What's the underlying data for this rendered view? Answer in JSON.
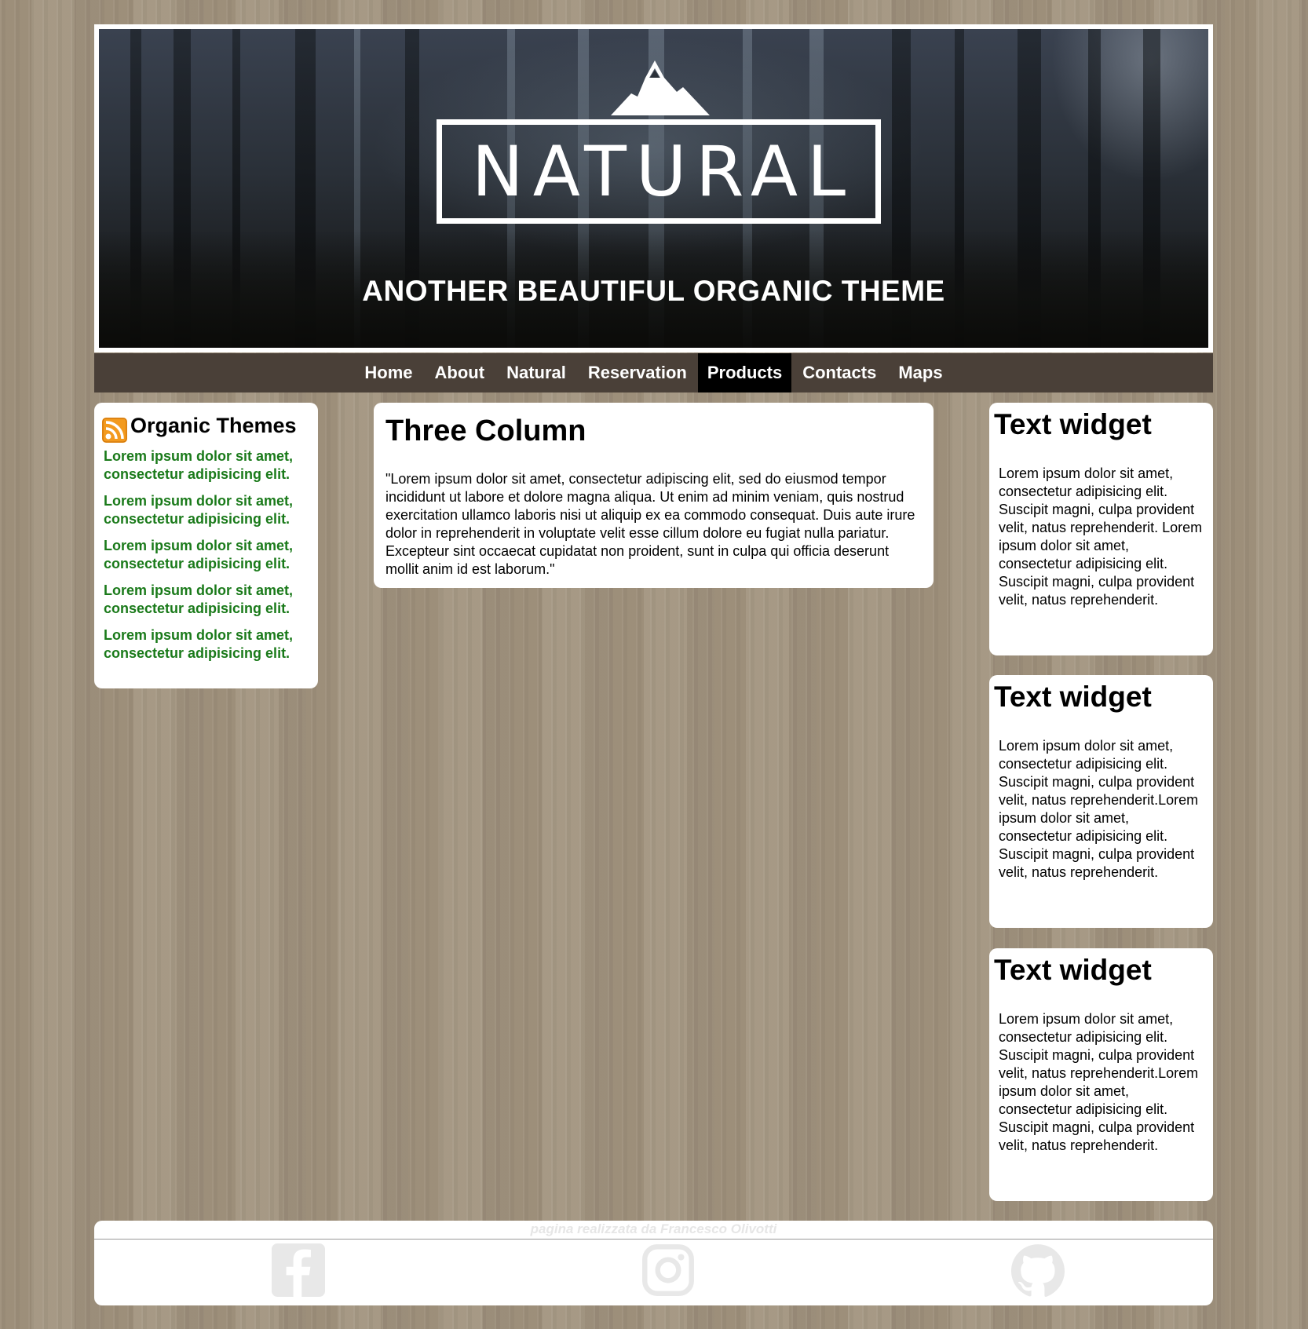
{
  "header": {
    "logo_text": "NATURAL",
    "tagline": "ANOTHER BEAUTIFUL ORGANIC THEME"
  },
  "nav": {
    "items": [
      {
        "label": "Home",
        "active": false
      },
      {
        "label": "About",
        "active": false
      },
      {
        "label": "Natural",
        "active": false
      },
      {
        "label": "Reservation",
        "active": false
      },
      {
        "label": "Products",
        "active": true
      },
      {
        "label": "Contacts",
        "active": false
      },
      {
        "label": "Maps",
        "active": false
      }
    ]
  },
  "sidebar_left": {
    "icon": "rss-icon",
    "title": "Organic Themes",
    "items": [
      "Lorem ipsum dolor sit amet, consectetur adipisicing elit.",
      "Lorem ipsum dolor sit amet, consectetur adipisicing elit.",
      "Lorem ipsum dolor sit amet, consectetur adipisicing elit.",
      "Lorem ipsum dolor sit amet, consectetur adipisicing elit.",
      "Lorem ipsum dolor sit amet, consectetur adipisicing elit."
    ]
  },
  "main": {
    "title": "Three Column",
    "text": "\"Lorem ipsum dolor sit amet, consectetur adipiscing elit, sed do eiusmod tempor incididunt ut labore et dolore magna aliqua. Ut enim ad minim veniam, quis nostrud exercitation ullamco laboris nisi ut aliquip ex ea commodo consequat. Duis aute irure dolor in reprehenderit in voluptate velit esse cillum dolore eu fugiat nulla pariatur. Excepteur sint occaecat cupidatat non proident, sunt in culpa qui officia deserunt mollit anim id est laborum.\""
  },
  "widgets": [
    {
      "title": "Text widget",
      "text": "Lorem ipsum dolor sit amet, consectetur adipisicing elit. Suscipit magni, culpa provident velit, natus reprehenderit. Lorem ipsum dolor sit amet, consectetur adipisicing elit. Suscipit magni, culpa provident velit, natus reprehenderit."
    },
    {
      "title": "Text widget",
      "text": "Lorem ipsum dolor sit amet, consectetur adipisicing elit. Suscipit magni, culpa provident velit, natus reprehenderit.Lorem ipsum dolor sit amet, consectetur adipisicing elit. Suscipit magni, culpa provident velit, natus reprehenderit."
    },
    {
      "title": "Text widget",
      "text": "Lorem ipsum dolor sit amet, consectetur adipisicing elit. Suscipit magni, culpa provident velit, natus reprehenderit.Lorem ipsum dolor sit amet, consectetur adipisicing elit. Suscipit magni, culpa provident velit, natus reprehenderit."
    }
  ],
  "footer": {
    "credit": "pagina realizzata da Francesco Olivotti",
    "social": [
      "facebook-icon",
      "instagram-icon",
      "github-icon"
    ]
  },
  "colors": {
    "page_background": "#a39580",
    "nav_background": "#4a4038",
    "nav_active": "#000000",
    "feed_link": "#1a7a1a",
    "rss_orange": "#f39a1e"
  }
}
